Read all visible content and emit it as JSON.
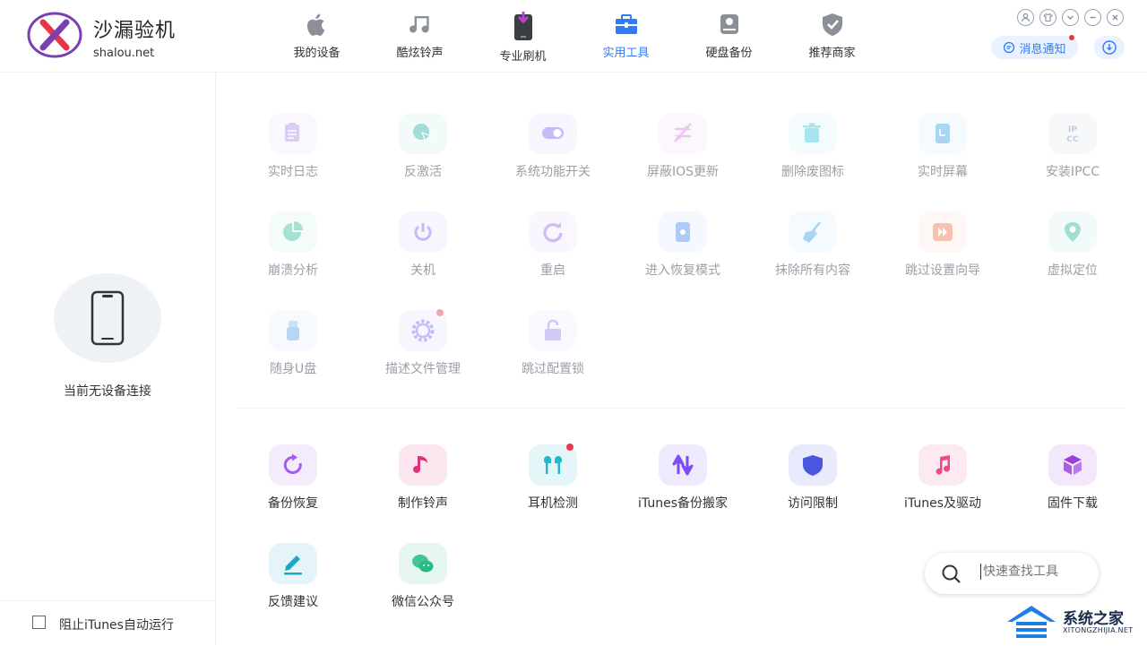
{
  "brand": {
    "title": "沙漏验机",
    "domain": "shalou.net"
  },
  "nav": [
    {
      "label": "我的设备",
      "icon": "apple-icon"
    },
    {
      "label": "酷炫铃声",
      "icon": "music-note-icon"
    },
    {
      "label": "专业刷机",
      "icon": "flash-phone-icon"
    },
    {
      "label": "实用工具",
      "icon": "toolbox-icon",
      "active": true
    },
    {
      "label": "硬盘备份",
      "icon": "hard-disk-icon"
    },
    {
      "label": "推荐商家",
      "icon": "shield-check-icon"
    }
  ],
  "header": {
    "notice_label": "消息通知"
  },
  "sidebar": {
    "no_device": "当前无设备连接",
    "block_itunes": "阻止iTunes自动运行"
  },
  "tools_dimmed": [
    {
      "label": "实时日志",
      "icon": "log-icon",
      "color": "#a98ff0"
    },
    {
      "label": "反激活",
      "icon": "cursor-icon",
      "color": "#2fb6a3"
    },
    {
      "label": "系统功能开关",
      "icon": "toggle-icon",
      "color": "#7b6cf0"
    },
    {
      "label": "屏蔽IOS更新",
      "icon": "block-update-icon",
      "color": "#d77be6"
    },
    {
      "label": "删除废图标",
      "icon": "trash-icon",
      "color": "#3fc4d8"
    },
    {
      "label": "实时屏幕",
      "icon": "screen-icon",
      "color": "#3fa4e8"
    },
    {
      "label": "安装IPCC",
      "icon": "ipcc-icon",
      "color": "#7d8fb0",
      "glyph": "IP CC"
    },
    {
      "label": "崩溃分析",
      "icon": "pie-chart-icon",
      "color": "#37c29a"
    },
    {
      "label": "关机",
      "icon": "power-icon",
      "color": "#7b6cf0"
    },
    {
      "label": "重启",
      "icon": "restart-icon",
      "color": "#9b6cf0"
    },
    {
      "label": "进入恢复模式",
      "icon": "recovery-icon",
      "color": "#4d8df0"
    },
    {
      "label": "抹除所有内容",
      "icon": "broom-icon",
      "color": "#3fa4e8"
    },
    {
      "label": "跳过设置向导",
      "icon": "skip-icon",
      "color": "#f07a55"
    },
    {
      "label": "虚拟定位",
      "icon": "location-icon",
      "color": "#2fb6a3"
    },
    {
      "label": "随身U盘",
      "icon": "usb-icon",
      "color": "#5da8e8"
    },
    {
      "label": "描述文件管理",
      "icon": "gear-icon",
      "color": "#7b6cf0",
      "badge": true
    },
    {
      "label": "跳过配置锁",
      "icon": "unlock-icon",
      "color": "#9b8cf0"
    }
  ],
  "tools_active": [
    {
      "label": "备份恢复",
      "icon": "backup-restore-icon",
      "color": "#a45cf0"
    },
    {
      "label": "制作铃声",
      "icon": "music-note-icon",
      "color": "#e0317a"
    },
    {
      "label": "耳机检测",
      "icon": "earphone-icon",
      "color": "#22b8c8",
      "badge": true
    },
    {
      "label": "iTunes备份搬家",
      "icon": "transfer-icon",
      "color": "#7b4cf0"
    },
    {
      "label": "访问限制",
      "icon": "shield-icon",
      "color": "#4a55e0"
    },
    {
      "label": "iTunes及驱动",
      "icon": "itunes-icon",
      "color": "#ee4a8a"
    },
    {
      "label": "固件下载",
      "icon": "cube-icon",
      "color": "#9a3ee0"
    },
    {
      "label": "反馈建议",
      "icon": "edit-icon",
      "color": "#1ea6c8"
    },
    {
      "label": "微信公众号",
      "icon": "wechat-icon",
      "color": "#2aba84"
    }
  ],
  "search": {
    "placeholder": "快速查找工具"
  },
  "watermark": {
    "name": "系统之家",
    "url": "XITONGZHIJIA.NET"
  }
}
